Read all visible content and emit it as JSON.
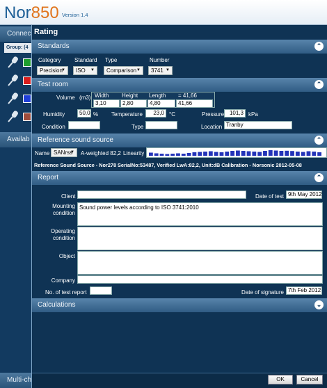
{
  "app": {
    "name": "Nor",
    "model": "850",
    "version": "Version 1.4"
  },
  "sidebar": {
    "connect": "Connec",
    "group": "Group:  (4",
    "available": "Availab",
    "multi": "Multi-ch"
  },
  "dialog": {
    "title": "Rating",
    "ok": "OK",
    "cancel": "Cancel"
  },
  "standards": {
    "header": "Standards",
    "category_label": "Category",
    "category": "Precision",
    "standard_label": "Standard",
    "standard": "ISO",
    "type_label": "Type",
    "type": "Comparison",
    "number_label": "Number",
    "number": "3741"
  },
  "testroom": {
    "header": "Test room",
    "volume_label": "Volume",
    "unit": "(m3)",
    "width_label": "Width",
    "height_label": "Height",
    "length_label": "Length",
    "volume_eq": "= 41,66",
    "width": "3,10",
    "height": "2,80",
    "length": "4,80",
    "volume": "41,66",
    "humidity_label": "Humidity",
    "humidity": "50,0",
    "humidity_unit": "%",
    "temperature_label": "Temperature",
    "temperature": "23,0",
    "temperature_unit": "°C",
    "pressure_label": "Pressure",
    "pressure": "101,3",
    "pressure_unit": "kPa",
    "condition_label": "Condition",
    "condition": "",
    "type_label": "Type",
    "type": "",
    "location_label": "Location",
    "location": "Tranby"
  },
  "refsource": {
    "header": "Reference sound source",
    "name_label": "Name",
    "name": "SANrss",
    "aweighted": "A-weighted  82,2",
    "linearity": "Linearity",
    "info": "Reference Sound Source - Nor278  SerialNo:53487, Verified LwA:82,2, Unit:dB   Calibration - Norsonic 2012-05-08"
  },
  "report": {
    "header": "Report",
    "client_label": "Client",
    "client": "",
    "date_test_label": "Date of test",
    "date_test": "9th May 2012",
    "mounting_label": "Mounting\ncondition",
    "mounting": "Sound power levels according to ISO 3741:2010",
    "operating_label": "Operating\ncondition",
    "operating": "",
    "object_label": "Object",
    "object": "",
    "company_label": "Company",
    "company": "",
    "testreport_label": "No. of test report",
    "testreport": "",
    "date_sig_label": "Date of signature",
    "date_sig": "7th Feb 2012"
  },
  "calculations": {
    "header": "Calculations"
  },
  "spectrum": [
    0.45,
    0.35,
    0.3,
    0.25,
    0.3,
    0.35,
    0.3,
    0.4,
    0.5,
    0.55,
    0.6,
    0.65,
    0.55,
    0.5,
    0.6,
    0.7,
    0.75,
    0.7,
    0.65,
    0.6,
    0.55,
    0.7,
    0.8,
    0.75,
    0.7,
    0.72,
    0.68,
    0.6,
    0.55,
    0.65,
    0.6,
    0.5
  ]
}
